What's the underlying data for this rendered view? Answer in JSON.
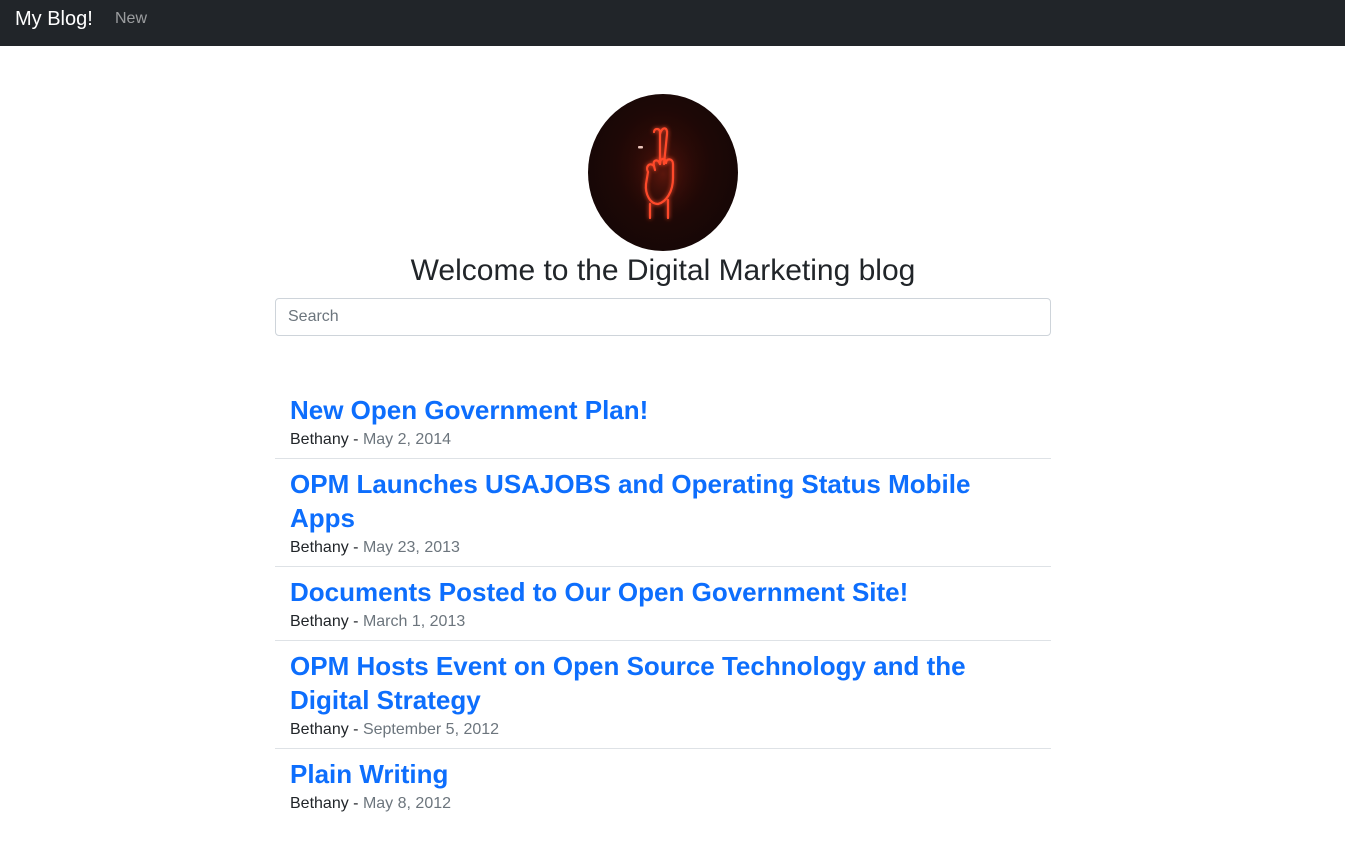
{
  "navbar": {
    "brand": "My Blog!",
    "links": [
      "New"
    ]
  },
  "hero": {
    "avatar_icon": "neon-crossed-fingers-image",
    "title": "Welcome to the Digital Marketing blog"
  },
  "search": {
    "placeholder": "Search",
    "value": ""
  },
  "posts": [
    {
      "title": "New Open Government Plan!",
      "author": "Bethany",
      "separator": "-",
      "date": "May 2, 2014"
    },
    {
      "title": "OPM Launches USAJOBS and Operating Status Mobile Apps",
      "author": "Bethany",
      "separator": "-",
      "date": "May 23, 2013"
    },
    {
      "title": "Documents Posted to Our Open Government Site!",
      "author": "Bethany",
      "separator": "-",
      "date": "March 1, 2013"
    },
    {
      "title": "OPM Hosts Event on Open Source Technology and the Digital Strategy",
      "author": "Bethany",
      "separator": "-",
      "date": "September 5, 2012"
    },
    {
      "title": "Plain Writing",
      "author": "Bethany",
      "separator": "-",
      "date": "May 8, 2012"
    }
  ],
  "colors": {
    "navbar_bg": "#212529",
    "link": "#0d6efd",
    "muted": "#6c757d",
    "neon": "#ff4a2a"
  }
}
